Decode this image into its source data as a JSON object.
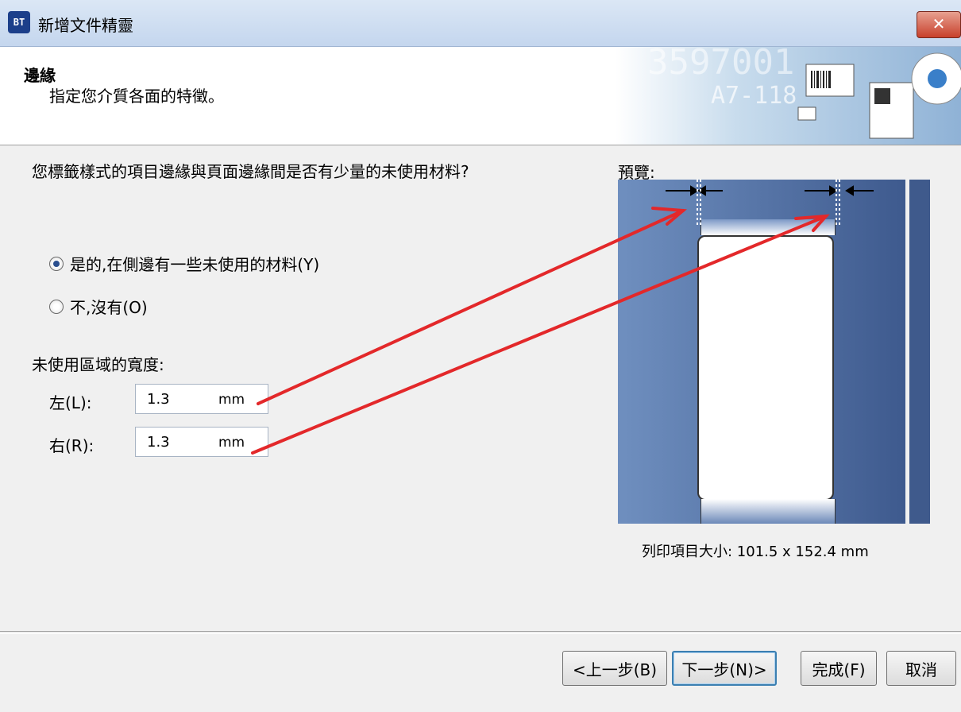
{
  "titlebar": {
    "icon_text": "BT",
    "title": "新增文件精靈",
    "close_label": "✕"
  },
  "header": {
    "title": "邊緣",
    "subtitle": "指定您介質各面的特徵。",
    "banner_number": "3597001",
    "banner_code": "A7-118"
  },
  "question": "您標籤樣式的項目邊緣與頁面邊緣間是否有少量的未使用材料?",
  "options": {
    "yes": "是的,在側邊有一些未使用的材料(Y)",
    "no": "不,沒有(O)",
    "selected": "yes"
  },
  "unused_width": {
    "label": "未使用區域的寬度:",
    "left_label": "左(L):",
    "left_value": "1.3",
    "right_label": "右(R):",
    "right_value": "1.3",
    "unit": "mm"
  },
  "preview": {
    "label": "預覽:",
    "print_size": "列印項目大小: 101.5 x 152.4 mm"
  },
  "buttons": {
    "back": "<上一步(B)",
    "next": "下一步(N)>",
    "finish": "完成(F)",
    "cancel": "取消"
  },
  "colors": {
    "annotation_arrow": "#e3282a",
    "preview_bg": "#4f6ea3"
  }
}
